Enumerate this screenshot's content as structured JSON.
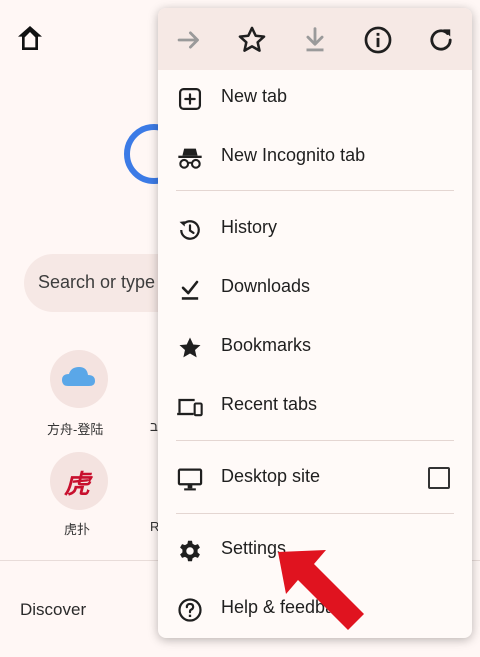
{
  "background": {
    "search_placeholder": "Search or type",
    "tiles": [
      {
        "label": "方舟-登陆",
        "icon": "cloud-icon"
      },
      {
        "label": "虎扑",
        "glyph": "虎"
      }
    ],
    "partial_labels": [
      "ב",
      "R"
    ],
    "discover_label": "Discover"
  },
  "toolbar": {
    "icons": [
      "forward-icon",
      "star-icon",
      "download-icon",
      "info-icon",
      "reload-icon"
    ]
  },
  "menu": {
    "new_tab": "New tab",
    "new_incognito_tab": "New Incognito tab",
    "history": "History",
    "downloads": "Downloads",
    "bookmarks": "Bookmarks",
    "recent_tabs": "Recent tabs",
    "desktop_site": "Desktop site",
    "settings": "Settings",
    "help_feedback": "Help & feedback"
  },
  "colors": {
    "accent_red": "#e0131f",
    "tile_red": "#c8102e",
    "ring_blue": "#3c7be6",
    "cloud_blue": "#5aa7e8"
  }
}
